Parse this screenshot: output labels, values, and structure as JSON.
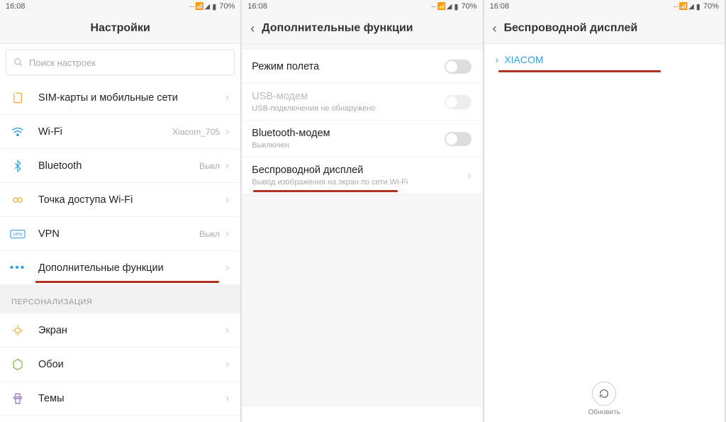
{
  "status": {
    "time": "16:08",
    "battery": "70%",
    "signals": "··· ▾◢"
  },
  "screen1": {
    "title": "Настройки",
    "search_placeholder": "Поиск настроек",
    "items": [
      {
        "label": "SIM-карты и мобильные сети",
        "value": ""
      },
      {
        "label": "Wi-Fi",
        "value": "Xiacom_705"
      },
      {
        "label": "Bluetooth",
        "value": "Выкл"
      },
      {
        "label": "Точка доступа Wi-Fi",
        "value": ""
      },
      {
        "label": "VPN",
        "value": "Выкл"
      },
      {
        "label": "Дополнительные функции",
        "value": ""
      }
    ],
    "section2": "ПЕРСОНАЛИЗАЦИЯ",
    "items2": [
      {
        "label": "Экран"
      },
      {
        "label": "Обои"
      },
      {
        "label": "Темы"
      }
    ]
  },
  "screen2": {
    "title": "Дополнительные функции",
    "rows": {
      "airplane": {
        "label": "Режим полета"
      },
      "usb": {
        "label": "USB-модем",
        "sub": "USB-подключения не обнаружено"
      },
      "bt": {
        "label": "Bluetooth-модем",
        "sub": "Выключен"
      },
      "wdisp": {
        "label": "Беспроводной дисплей",
        "sub": "Вывод изображения на экран по сети Wi-Fi"
      }
    }
  },
  "screen3": {
    "title": "Беспроводной дисплей",
    "device": "XIACOM",
    "refresh": "Обновить"
  }
}
